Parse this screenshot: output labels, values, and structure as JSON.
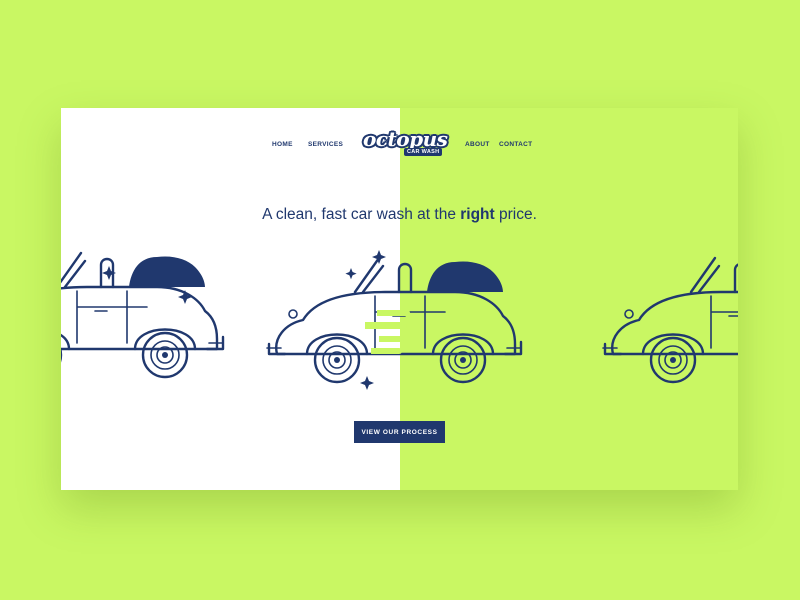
{
  "colors": {
    "accent_green": "#c9f763",
    "navy": "#20386e",
    "white": "#ffffff"
  },
  "nav": {
    "home": "HOME",
    "services": "SERVICES",
    "about": "ABOUT",
    "contact": "CONTACT"
  },
  "logo": {
    "word": "octopus",
    "sub": "CAR WASH"
  },
  "hero": {
    "headline_before": "A clean, fast car wash at the ",
    "headline_bold": "right",
    "headline_after": " price.",
    "cta_label": "VIEW OUR PROCESS"
  },
  "illustration": {
    "cars": [
      "car-left-partial",
      "car-center-washing",
      "car-right-partial"
    ],
    "icons": [
      "sparkle-icon",
      "cleaning-streak"
    ]
  }
}
